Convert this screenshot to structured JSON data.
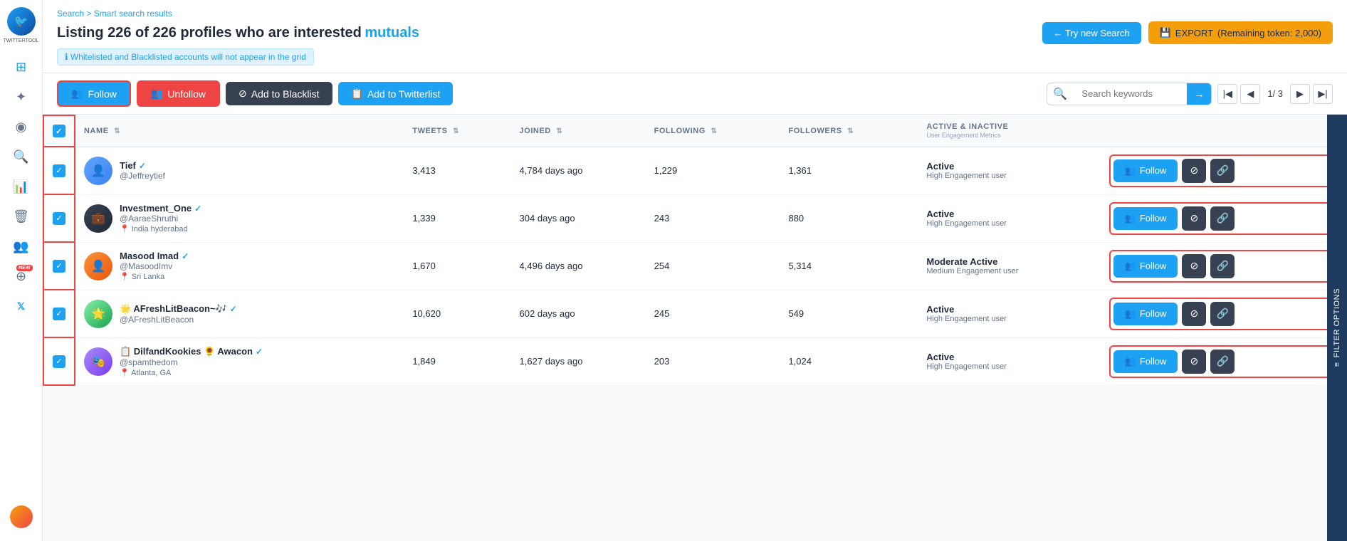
{
  "app": {
    "name": "TWITTERTOOL"
  },
  "breadcrumb": {
    "root": "Search",
    "separator": ">",
    "current": "Smart search results"
  },
  "page": {
    "title_prefix": "Listing 226 of 226 profiles who are interested",
    "title_highlight": "mutuals",
    "info_message": "ℹ Whitelisted and Blacklisted accounts will not appear in the grid"
  },
  "header_actions": {
    "try_new_search": "← Try new Search",
    "export_label": "EXPORT",
    "export_tokens": "(Remaining token: 2,000)"
  },
  "toolbar": {
    "follow_label": "Follow",
    "unfollow_label": "Unfollow",
    "blacklist_label": "Add to Blacklist",
    "twitterlist_label": "Add to Twitterlist",
    "search_placeholder": "Search keywords",
    "pagination": {
      "current": "1",
      "total": "3",
      "display": "1/ 3"
    }
  },
  "table": {
    "columns": {
      "name": "NAME",
      "tweets": "TWEETS",
      "joined": "JOINED",
      "following": "FOLLOWING",
      "followers": "FOLLOWERS",
      "active_inactive": "ACTIVE & INACTIVE",
      "active_inactive_sub": "User Engagement Metrics"
    },
    "rows": [
      {
        "id": 1,
        "name": "Tief",
        "verified": true,
        "handle": "@Jeffreytief",
        "location": "",
        "avatar_color": "blue",
        "avatar_emoji": "",
        "tweets": "3,413",
        "joined": "4,784 days ago",
        "following": "1,229",
        "followers": "1,361",
        "status": "Active",
        "engagement": "High Engagement user"
      },
      {
        "id": 2,
        "name": "Investment_One",
        "verified": true,
        "handle": "@AaraeShruthi",
        "location": "India hyderabad",
        "avatar_color": "dark",
        "avatar_emoji": "",
        "tweets": "1,339",
        "joined": "304 days ago",
        "following": "243",
        "followers": "880",
        "status": "Active",
        "engagement": "High Engagement user"
      },
      {
        "id": 3,
        "name": "Masood Imad",
        "verified": true,
        "handle": "@MasoodImv",
        "location": "Sri Lanka",
        "avatar_color": "orange",
        "avatar_emoji": "",
        "tweets": "1,670",
        "joined": "4,496 days ago",
        "following": "254",
        "followers": "5,314",
        "status": "Moderate Active",
        "engagement": "Medium Engagement user"
      },
      {
        "id": 4,
        "name": "🌟 AFreshLitBeacon~🎶",
        "verified": true,
        "handle": "@AFreshLitBeacon",
        "location": "",
        "avatar_color": "green",
        "avatar_emoji": "🌟",
        "tweets": "10,620",
        "joined": "602 days ago",
        "following": "245",
        "followers": "549",
        "status": "Active",
        "engagement": "High Engagement user"
      },
      {
        "id": 5,
        "name": "📋 DilfandKookies 🌻 Awacon",
        "verified": true,
        "handle": "@spamthedom",
        "location": "Atlanta, GA",
        "avatar_color": "purple",
        "avatar_emoji": "🎭",
        "tweets": "1,849",
        "joined": "1,627 days ago",
        "following": "203",
        "followers": "1,024",
        "status": "Active",
        "engagement": "High Engagement user"
      }
    ],
    "actions": {
      "follow": "Follow",
      "ban_icon": "⊘",
      "link_icon": "🔗"
    }
  },
  "filter_options": "FILTER OPTIONS"
}
